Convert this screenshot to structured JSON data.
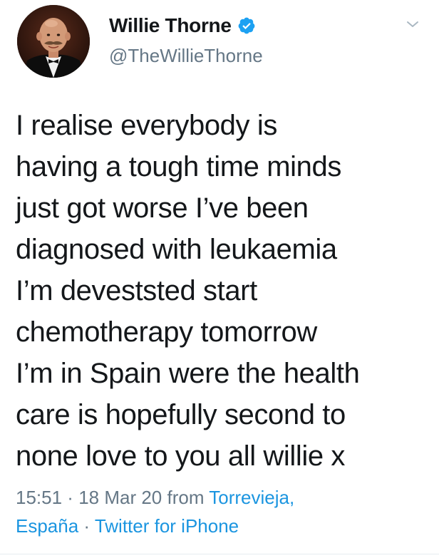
{
  "user": {
    "display_name": "Willie Thorne",
    "handle": "@TheWillieThorne",
    "verified": true,
    "avatar_icon": "profile-photo"
  },
  "tweet": {
    "lines": [
      "I realise everybody is",
      "having a tough time minds",
      "just got worse I’ve been",
      "diagnosed with leukaemia",
      "I’m deveststed start",
      "chemotherapy tomorrow",
      "I’m in Spain were the health",
      "care is hopefully second to",
      "none love to you all willie x"
    ]
  },
  "meta": {
    "time": "15:51",
    "separator": " · ",
    "date": "18 Mar 20",
    "from_label": " from ",
    "location_part1": "Torrevieja,",
    "location_part2": "España",
    "source": "Twitter for iPhone"
  },
  "colors": {
    "text": "#14171a",
    "secondary": "#657786",
    "link": "#1b95e0",
    "verified": "#1da1f2",
    "divider": "#e6ecf0"
  },
  "icons": {
    "verified": "verified-badge-icon",
    "menu": "chevron-down-icon"
  }
}
